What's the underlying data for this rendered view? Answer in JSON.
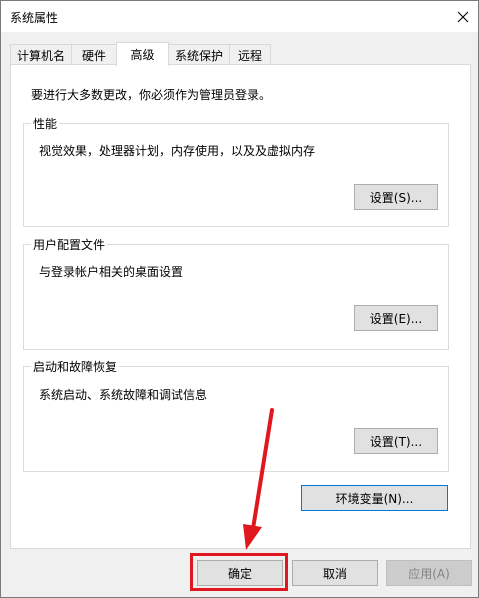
{
  "window": {
    "title": "系统属性",
    "close_glyph": "✕"
  },
  "tabs": [
    {
      "label": "计算机名"
    },
    {
      "label": "硬件"
    },
    {
      "label": "高级",
      "active": true
    },
    {
      "label": "系统保护"
    },
    {
      "label": "远程"
    }
  ],
  "intro": "要进行大多数更改，你必须作为管理员登录。",
  "performance": {
    "title": "性能",
    "desc": "视觉效果，处理器计划，内存使用，以及及虚拟内存",
    "button": "设置(S)..."
  },
  "user_profiles": {
    "title": "用户配置文件",
    "desc": "与登录帐户相关的桌面设置",
    "button": "设置(E)..."
  },
  "startup_recovery": {
    "title": "启动和故障恢复",
    "desc": "系统启动、系统故障和调试信息",
    "button": "设置(T)..."
  },
  "env_vars_button": "环境变量(N)...",
  "footer": {
    "ok": "确定",
    "cancel": "取消",
    "apply": "应用(A)"
  },
  "colors": {
    "accent": "#0078d7",
    "annotation": "#e0181d"
  },
  "icons": {
    "close": "close-icon",
    "annotation": "red-arrow-icon"
  }
}
